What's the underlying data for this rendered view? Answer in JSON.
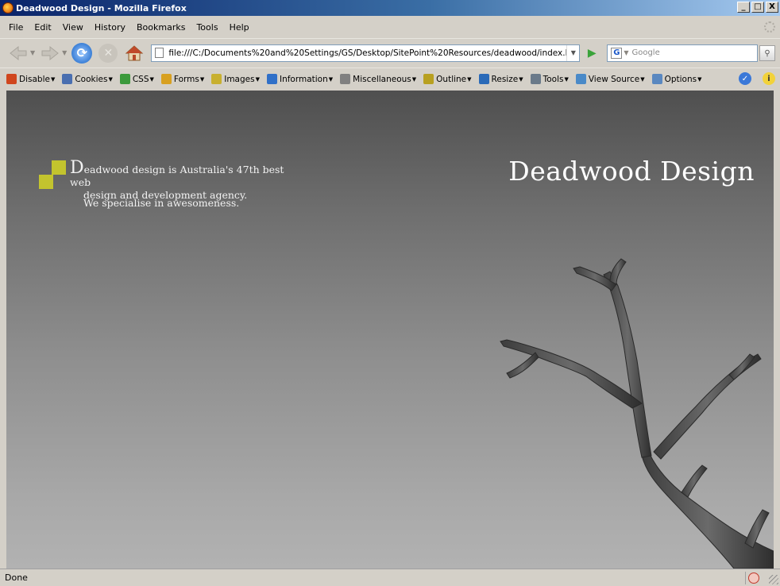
{
  "window": {
    "title": "Deadwood Design - Mozilla Firefox",
    "min": "_",
    "max": "□",
    "close": "X"
  },
  "menu": {
    "file": "File",
    "edit": "Edit",
    "view": "View",
    "history": "History",
    "bookmarks": "Bookmarks",
    "tools": "Tools",
    "help": "Help"
  },
  "nav": {
    "url": "file:///C:/Documents%20and%20Settings/GS/Desktop/SitePoint%20Resources/deadwood/index.html",
    "search_placeholder": "Google",
    "search_engine": "G"
  },
  "devbar": {
    "items": [
      {
        "label": "Disable",
        "color": "#d0461e"
      },
      {
        "label": "Cookies",
        "color": "#4a6fb0"
      },
      {
        "label": "CSS",
        "color": "#3c9a3c"
      },
      {
        "label": "Forms",
        "color": "#d8a020"
      },
      {
        "label": "Images",
        "color": "#c8b030"
      },
      {
        "label": "Information",
        "color": "#3070c8"
      },
      {
        "label": "Miscellaneous",
        "color": "#808080"
      },
      {
        "label": "Outline",
        "color": "#b8a020"
      },
      {
        "label": "Resize",
        "color": "#2a6ab8"
      },
      {
        "label": "Tools",
        "color": "#6a7a8a"
      },
      {
        "label": "View Source",
        "color": "#4a8ac8"
      },
      {
        "label": "Options",
        "color": "#5a88c0"
      }
    ]
  },
  "page": {
    "intro_drop": "D",
    "intro_line1": "eadwood design is Australia's 47th best web",
    "intro_line2": "design and development agency.",
    "tagline": "We specialise in awesomeness.",
    "site_title": "Deadwood Design",
    "accent_color": "#c3c42e"
  },
  "status": {
    "text": "Done"
  }
}
